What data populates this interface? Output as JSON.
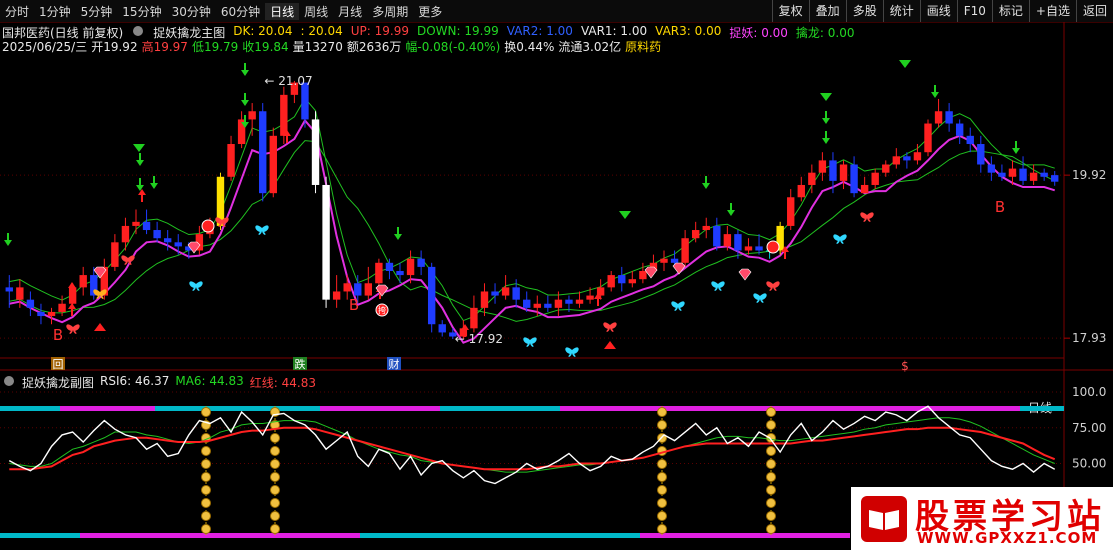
{
  "toolbar": {
    "periods": [
      "分时",
      "1分钟",
      "5分钟",
      "15分钟",
      "30分钟",
      "60分钟",
      "日线",
      "周线",
      "月线",
      "多周期",
      "更多"
    ],
    "active_period": "日线",
    "tools": [
      "复权",
      "叠加",
      "多股",
      "统计",
      "画线",
      "F10",
      "标记",
      "+自选",
      "返回"
    ]
  },
  "info": {
    "stock": "国邦医药(日线 前复权)",
    "indicator": "捉妖擒龙主图",
    "dk": "DK: 20.04",
    "dk2": ": 20.04",
    "up": "UP: 19.99",
    "down": "DOWN: 19.99",
    "var2": "VAR2: 1.00",
    "var1": "VAR1: 1.00",
    "var3": "VAR3: 0.00",
    "zhuoyao": "捉妖: 0.00",
    "qinlong": "擒龙: 0.00",
    "date": "2025/06/25/三",
    "open": "开19.92",
    "high": "高19.97",
    "low": "低19.79",
    "close": "收19.84",
    "volume": "量13270",
    "amount": "额2636万",
    "change": "幅-0.08(-0.40%)",
    "turnover": "换0.44%",
    "float": "流通3.02亿",
    "sector": "原料药"
  },
  "price_axis": [
    "19.92",
    "17.93"
  ],
  "annotations": {
    "high_label": "21.07",
    "low_label": "17.92",
    "buy_marks": [
      "B",
      "B",
      "B"
    ],
    "event_marks": [
      "回",
      "跌",
      "财",
      "$"
    ],
    "diamond_text": "挎"
  },
  "sub": {
    "title": "捉妖擒龙副图",
    "rsi6": "RSI6: 46.37",
    "ma6": "MA6: 44.83",
    "redline": "红线: 44.83",
    "axis": [
      "100.0",
      "75.00",
      "50.00"
    ],
    "period_tag": "日线"
  },
  "watermark": {
    "title": "股票学习站",
    "url": "WWW.GPXXZ1.COM"
  },
  "colors": {
    "up": "#ff2020",
    "down": "#1f3cff",
    "flat": "#00d8d8",
    "green": "#20c020",
    "magenta": "#e030e0",
    "yellow": "#ffe000",
    "white": "#ffffff"
  },
  "chart_data": {
    "type": "candlestick",
    "price_ylim": [
      17.7,
      21.35
    ],
    "candles": [
      [
        18.55,
        18.5,
        18.7,
        18.3
      ],
      [
        18.4,
        18.55,
        18.65,
        18.3
      ],
      [
        18.4,
        18.3,
        18.5,
        18.2
      ],
      [
        18.25,
        18.2,
        18.35,
        18.1
      ],
      [
        18.2,
        18.25,
        18.3,
        18.1
      ],
      [
        18.25,
        18.35,
        18.45,
        18.2
      ],
      [
        18.35,
        18.55,
        18.6,
        18.25
      ],
      [
        18.55,
        18.7,
        18.8,
        18.45
      ],
      [
        18.7,
        18.45,
        18.8,
        18.4
      ],
      [
        18.45,
        18.8,
        18.9,
        18.4
      ],
      [
        18.8,
        19.1,
        19.2,
        18.75
      ],
      [
        19.1,
        19.3,
        19.4,
        19.0
      ],
      [
        19.3,
        19.35,
        19.5,
        19.2
      ],
      [
        19.35,
        19.25,
        19.5,
        19.2
      ],
      [
        19.25,
        19.15,
        19.35,
        19.1
      ],
      [
        19.15,
        19.1,
        19.25,
        19.0
      ],
      [
        19.1,
        19.05,
        19.2,
        18.95
      ],
      [
        19.05,
        19.0,
        19.1,
        18.9
      ],
      [
        19.0,
        19.2,
        19.3,
        18.95
      ],
      [
        19.2,
        19.3,
        19.4,
        19.15
      ],
      [
        19.3,
        19.9,
        19.95,
        19.25
      ],
      [
        19.9,
        20.3,
        20.4,
        19.85
      ],
      [
        20.3,
        20.6,
        20.7,
        20.25
      ],
      [
        20.6,
        20.7,
        20.8,
        20.4
      ],
      [
        20.7,
        19.7,
        20.8,
        19.6
      ],
      [
        19.7,
        20.4,
        20.5,
        19.65
      ],
      [
        20.4,
        20.9,
        21.0,
        20.3
      ],
      [
        20.9,
        21.05,
        21.07,
        20.8
      ],
      [
        21.05,
        20.6,
        21.0,
        20.5
      ],
      [
        20.6,
        19.8,
        20.7,
        19.7
      ],
      [
        19.8,
        18.4,
        19.9,
        18.3
      ],
      [
        18.4,
        18.5,
        18.7,
        18.3
      ],
      [
        18.5,
        18.6,
        18.7,
        18.4
      ],
      [
        18.6,
        18.45,
        18.7,
        18.35
      ],
      [
        18.45,
        18.6,
        18.8,
        18.4
      ],
      [
        18.6,
        18.85,
        18.9,
        18.5
      ],
      [
        18.85,
        18.75,
        18.9,
        18.65
      ],
      [
        18.75,
        18.7,
        18.85,
        18.6
      ],
      [
        18.7,
        18.9,
        19.0,
        18.6
      ],
      [
        18.9,
        18.8,
        19.0,
        18.7
      ],
      [
        18.8,
        18.1,
        18.85,
        18.0
      ],
      [
        18.1,
        18.0,
        18.15,
        17.95
      ],
      [
        18.0,
        17.95,
        18.05,
        17.92
      ],
      [
        17.95,
        18.05,
        18.15,
        17.92
      ],
      [
        18.05,
        18.3,
        18.45,
        18.0
      ],
      [
        18.3,
        18.5,
        18.6,
        18.2
      ],
      [
        18.5,
        18.45,
        18.6,
        18.35
      ],
      [
        18.45,
        18.55,
        18.7,
        18.4
      ],
      [
        18.55,
        18.4,
        18.65,
        18.3
      ],
      [
        18.4,
        18.3,
        18.5,
        18.25
      ],
      [
        18.3,
        18.35,
        18.45,
        18.2
      ],
      [
        18.35,
        18.3,
        18.45,
        18.25
      ],
      [
        18.3,
        18.4,
        18.5,
        18.2
      ],
      [
        18.4,
        18.35,
        18.45,
        18.25
      ],
      [
        18.35,
        18.4,
        18.5,
        18.3
      ],
      [
        18.4,
        18.45,
        18.55,
        18.35
      ],
      [
        18.45,
        18.55,
        18.65,
        18.4
      ],
      [
        18.55,
        18.7,
        18.75,
        18.5
      ],
      [
        18.7,
        18.6,
        18.8,
        18.5
      ],
      [
        18.6,
        18.65,
        18.75,
        18.55
      ],
      [
        18.65,
        18.75,
        18.85,
        18.6
      ],
      [
        18.75,
        18.85,
        18.95,
        18.7
      ],
      [
        18.85,
        18.9,
        19.0,
        18.75
      ],
      [
        18.9,
        18.85,
        19.0,
        18.8
      ],
      [
        18.85,
        19.15,
        19.25,
        18.8
      ],
      [
        19.15,
        19.25,
        19.35,
        19.1
      ],
      [
        19.25,
        19.3,
        19.4,
        19.15
      ],
      [
        19.3,
        19.05,
        19.4,
        19.0
      ],
      [
        19.05,
        19.2,
        19.3,
        19.0
      ],
      [
        19.2,
        19.0,
        19.25,
        18.9
      ],
      [
        19.0,
        19.05,
        19.15,
        18.95
      ],
      [
        19.05,
        19.0,
        19.2,
        18.95
      ],
      [
        19.0,
        19.0,
        19.1,
        18.9
      ],
      [
        19.0,
        19.3,
        19.35,
        18.95
      ],
      [
        19.3,
        19.65,
        19.75,
        19.25
      ],
      [
        19.65,
        19.8,
        19.9,
        19.6
      ],
      [
        19.8,
        19.95,
        20.05,
        19.7
      ],
      [
        19.95,
        20.1,
        20.2,
        19.85
      ],
      [
        20.1,
        19.85,
        20.2,
        19.7
      ],
      [
        19.85,
        20.05,
        20.1,
        19.75
      ],
      [
        20.05,
        19.7,
        20.15,
        19.65
      ],
      [
        19.7,
        19.8,
        19.9,
        19.7
      ],
      [
        19.8,
        19.95,
        20.0,
        19.75
      ],
      [
        19.95,
        20.05,
        20.1,
        19.9
      ],
      [
        20.05,
        20.15,
        20.25,
        20.0
      ],
      [
        20.15,
        20.1,
        20.2,
        20.0
      ],
      [
        20.1,
        20.2,
        20.3,
        20.05
      ],
      [
        20.2,
        20.55,
        20.6,
        20.15
      ],
      [
        20.55,
        20.7,
        20.85,
        20.5
      ],
      [
        20.7,
        20.55,
        20.8,
        20.45
      ],
      [
        20.55,
        20.4,
        20.6,
        20.3
      ],
      [
        20.4,
        20.3,
        20.5,
        20.2
      ],
      [
        20.3,
        20.05,
        20.4,
        19.95
      ],
      [
        20.05,
        19.95,
        20.15,
        19.85
      ],
      [
        19.95,
        19.9,
        20.05,
        19.85
      ],
      [
        19.9,
        20.0,
        20.1,
        19.8
      ],
      [
        20.0,
        19.85,
        20.15,
        19.8
      ],
      [
        19.85,
        19.95,
        20.05,
        19.8
      ],
      [
        19.95,
        19.9,
        20.0,
        19.85
      ],
      [
        19.92,
        19.84,
        19.97,
        19.79
      ]
    ],
    "rsi": [
      52,
      48,
      45,
      50,
      62,
      70,
      72,
      65,
      73,
      80,
      74,
      70,
      68,
      60,
      64,
      55,
      57,
      70,
      80,
      78,
      82,
      72,
      86,
      79,
      70,
      84,
      85,
      80,
      77,
      70,
      60,
      66,
      72,
      55,
      48,
      60,
      57,
      46,
      55,
      42,
      50,
      52,
      45,
      40,
      45,
      38,
      36,
      40,
      44,
      50,
      46,
      48,
      52,
      57,
      50,
      45,
      48,
      55,
      52,
      53,
      58,
      62,
      70,
      66,
      72,
      78,
      70,
      75,
      64,
      68,
      62,
      72,
      68,
      58,
      70,
      78,
      66,
      72,
      80,
      74,
      78,
      83,
      80,
      86,
      84,
      80,
      86,
      90,
      82,
      76,
      70,
      68,
      60,
      52,
      48,
      46,
      50,
      44,
      50,
      46
    ],
    "ma6": [
      50,
      49,
      48,
      48,
      50,
      55,
      60,
      62,
      65,
      68,
      72,
      72,
      72,
      70,
      69,
      67,
      65,
      64,
      65,
      68,
      72,
      74,
      77,
      78,
      78,
      79,
      80,
      80,
      80,
      79,
      76,
      73,
      70,
      66,
      63,
      60,
      58,
      56,
      55,
      52,
      51,
      50,
      49,
      48,
      47,
      46,
      45,
      44,
      44,
      44,
      45,
      46,
      47,
      48,
      49,
      49,
      50,
      51,
      52,
      53,
      54,
      56,
      58,
      60,
      62,
      64,
      66,
      68,
      69,
      69,
      68,
      68,
      67,
      66,
      66,
      67,
      68,
      69,
      70,
      71,
      72,
      74,
      75,
      77,
      78,
      79,
      80,
      81,
      82,
      82,
      81,
      79,
      76,
      72,
      68,
      64,
      60,
      56,
      53,
      50
    ],
    "redline": [
      46,
      46,
      46,
      47,
      48,
      52,
      56,
      58,
      62,
      64,
      66,
      67,
      68,
      68,
      67,
      66,
      65,
      65,
      65,
      66,
      68,
      70,
      72,
      73,
      73,
      74,
      75,
      75,
      75,
      74,
      72,
      70,
      68,
      66,
      64,
      62,
      60,
      58,
      56,
      54,
      52,
      50,
      49,
      48,
      47,
      46,
      46,
      46,
      46,
      46,
      47,
      48,
      48,
      49,
      50,
      50,
      50,
      51,
      52,
      53,
      54,
      56,
      58,
      60,
      62,
      63,
      64,
      64,
      64,
      64,
      64,
      64,
      64,
      64,
      64,
      65,
      66,
      66,
      67,
      68,
      69,
      70,
      71,
      72,
      73,
      74,
      74,
      75,
      75,
      75,
      74,
      73,
      72,
      70,
      68,
      66,
      64,
      60,
      56,
      53
    ]
  }
}
